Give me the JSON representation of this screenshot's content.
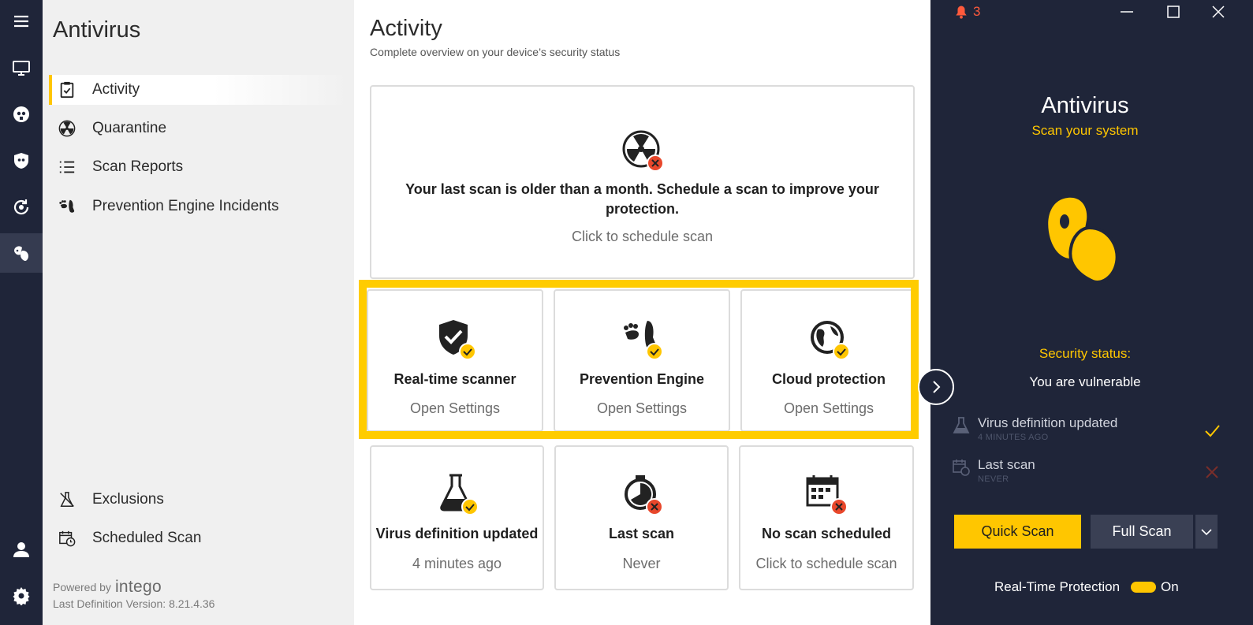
{
  "sidebar": {
    "title": "Antivirus",
    "items": [
      {
        "label": "Activity"
      },
      {
        "label": "Quarantine"
      },
      {
        "label": "Scan Reports"
      },
      {
        "label": "Prevention Engine Incidents"
      }
    ],
    "bottom_items": [
      {
        "label": "Exclusions"
      },
      {
        "label": "Scheduled Scan"
      }
    ],
    "powered_by": "Powered by",
    "brand": "intego",
    "definition_version": "Last Definition Version:  8.21.4.36"
  },
  "main": {
    "title": "Activity",
    "subtitle": "Complete overview on your device’s security status",
    "alert": {
      "title": "Your last scan is older than a month. Schedule a scan to improve your protection.",
      "action": "Click to schedule scan"
    },
    "cards": [
      {
        "title": "Real-time scanner",
        "sub": "Open Settings",
        "status": "ok"
      },
      {
        "title": "Prevention Engine",
        "sub": "Open Settings",
        "status": "ok"
      },
      {
        "title": "Cloud protection",
        "sub": "Open Settings",
        "status": "ok"
      },
      {
        "title": "Virus definition updated",
        "sub": "4 minutes ago",
        "status": "ok"
      },
      {
        "title": "Last scan",
        "sub": "Never",
        "status": "error"
      },
      {
        "title": "No scan scheduled",
        "sub": "Click to schedule scan",
        "status": "error"
      }
    ]
  },
  "panel": {
    "notifications": "3",
    "title": "Antivirus",
    "subtitle": "Scan your system",
    "security_label": "Security status:",
    "security_value": "You are vulnerable",
    "stats": [
      {
        "title": "Virus definition updated",
        "sub": "4 MINUTES AGO"
      },
      {
        "title": "Last scan",
        "sub": "NEVER"
      }
    ],
    "quick_scan": "Quick Scan",
    "full_scan": "Full Scan",
    "rtp_label": "Real-Time Protection",
    "rtp_state": "On"
  },
  "colors": {
    "accent": "#ffc600",
    "dark": "#1f2539",
    "error": "#e8472b"
  }
}
